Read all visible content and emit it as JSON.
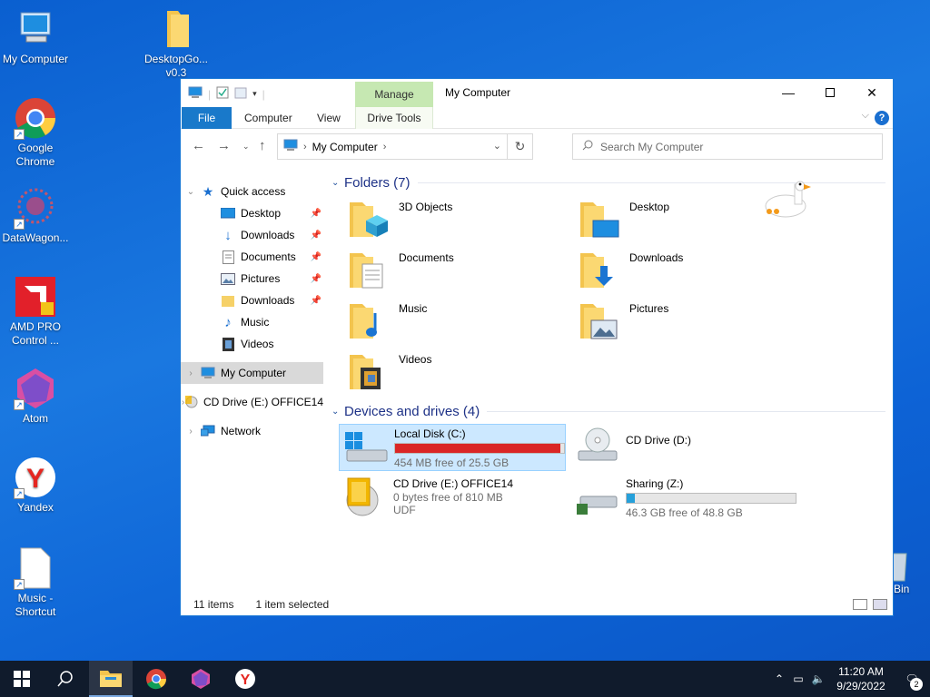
{
  "desktop": {
    "icons": [
      {
        "label": "My Computer",
        "icon": "computer-icon"
      },
      {
        "label": "DesktopGo...\nv0.3",
        "icon": "folder-icon"
      },
      {
        "label": "Google Chrome",
        "icon": "chrome-icon"
      },
      {
        "label": "DataWagon...",
        "icon": "datawagon-icon"
      },
      {
        "label": "AMD PRO Control ...",
        "icon": "amd-icon"
      },
      {
        "label": "Atom",
        "icon": "atom-icon"
      },
      {
        "label": "Yandex",
        "icon": "yandex-icon"
      },
      {
        "label": "Music - Shortcut",
        "icon": "file-icon"
      }
    ],
    "recycle_label": "Bin"
  },
  "window": {
    "title": "My Computer",
    "manage_tab": "Manage",
    "ribbon_tabs": [
      "File",
      "Computer",
      "View",
      "Drive Tools"
    ],
    "help": "?",
    "address": {
      "path": "My Computer"
    },
    "search": {
      "placeholder": "Search My Computer"
    }
  },
  "nav": {
    "quick_access": "Quick access",
    "items": [
      {
        "label": "Desktop",
        "icon": "desktop-icon",
        "pinned": true
      },
      {
        "label": "Downloads",
        "icon": "downloads-icon",
        "pinned": true
      },
      {
        "label": "Documents",
        "icon": "documents-icon",
        "pinned": true
      },
      {
        "label": "Pictures",
        "icon": "pictures-icon",
        "pinned": true
      },
      {
        "label": "Downloads",
        "icon": "folder-icon",
        "pinned": true
      },
      {
        "label": "Music",
        "icon": "music-icon",
        "pinned": false
      },
      {
        "label": "Videos",
        "icon": "videos-icon",
        "pinned": false
      }
    ],
    "my_computer": "My Computer",
    "cd_drive": "CD Drive (E:) OFFICE14",
    "network": "Network"
  },
  "content": {
    "folders_title": "Folders (7)",
    "folders": [
      {
        "name": "3D Objects"
      },
      {
        "name": "Desktop"
      },
      {
        "name": "Documents"
      },
      {
        "name": "Downloads"
      },
      {
        "name": "Music"
      },
      {
        "name": "Pictures"
      },
      {
        "name": "Videos"
      }
    ],
    "devices_title": "Devices and drives (4)",
    "drives": {
      "c": {
        "name": "Local Disk (C:)",
        "free": "454 MB free of 25.5 GB",
        "used_fraction": 0.98,
        "color": "#da2626"
      },
      "d": {
        "name": "CD Drive (D:)"
      },
      "e": {
        "name": "CD Drive (E:) OFFICE14",
        "free": "0 bytes free of 810 MB",
        "fs": "UDF"
      },
      "z": {
        "name": "Sharing (Z:)",
        "free": "46.3 GB free of 48.8 GB",
        "used_fraction": 0.05,
        "color": "#26a0da"
      }
    }
  },
  "status": {
    "items": "11 items",
    "selected": "1 item selected"
  },
  "taskbar": {
    "time": "11:20 AM",
    "date": "9/29/2022",
    "notifications": "2"
  }
}
